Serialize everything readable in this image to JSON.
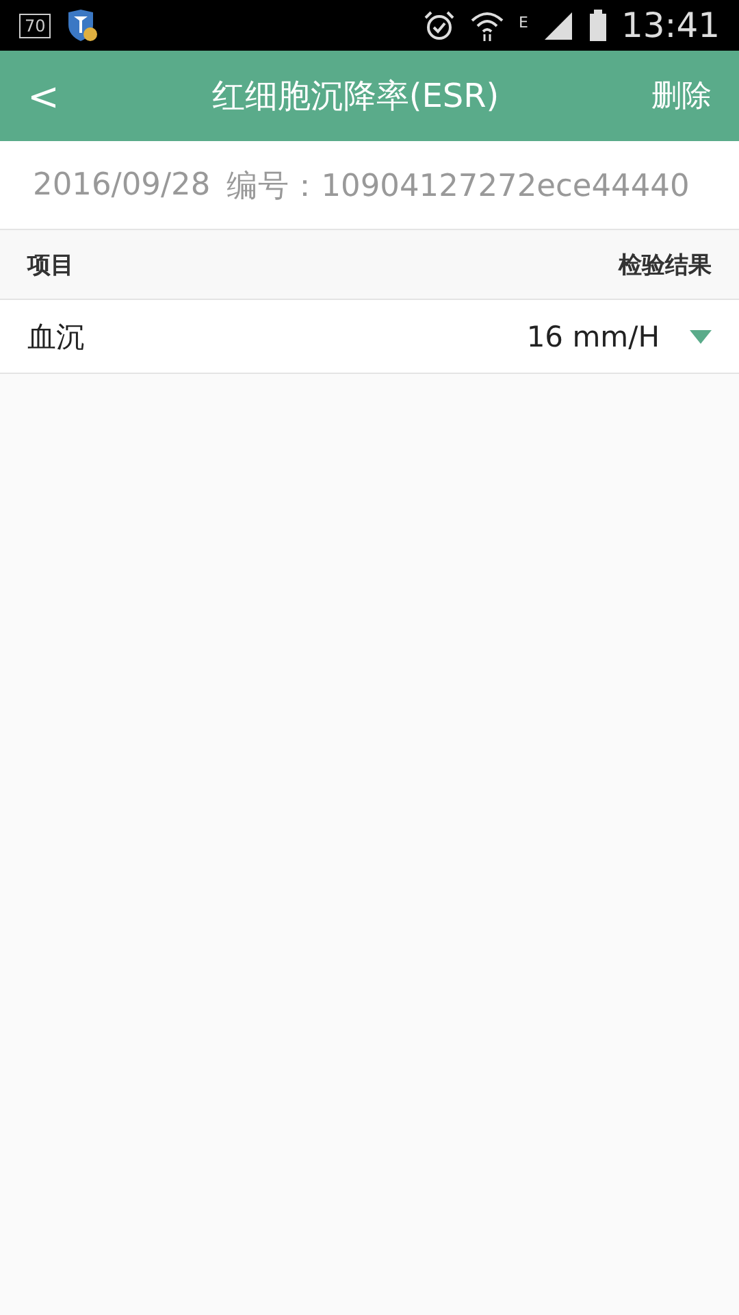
{
  "status_bar": {
    "badge": "70",
    "network": "E",
    "time": "13:41"
  },
  "header": {
    "back": "<",
    "title": "红细胞沉降率(ESR)",
    "action": "删除"
  },
  "info": {
    "date": "2016/09/28",
    "number": "编号：10904127272ece44440"
  },
  "table": {
    "columns": [
      "项目",
      "检验结果"
    ],
    "rows": [
      {
        "item": "血沉",
        "result": "16 mm/H",
        "expanded": false
      }
    ]
  }
}
